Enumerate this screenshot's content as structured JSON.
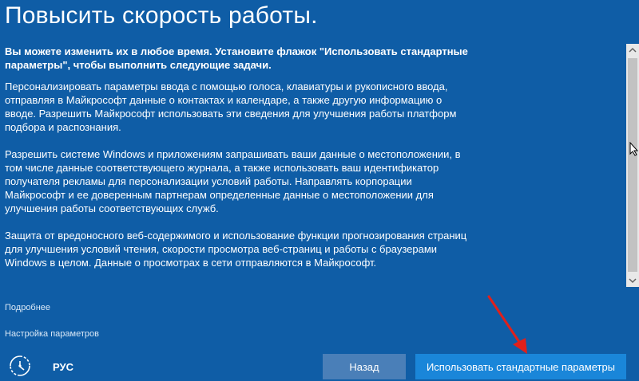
{
  "header": {
    "title": "Повысить скорость работы."
  },
  "intro": {
    "text": "Вы можете изменить их в любое время. Установите флажок \"Использовать стандартные параметры\", чтобы выполнить следующие задачи."
  },
  "paragraphs": [
    "Персонализировать параметры ввода с помощью голоса, клавиатуры и рукописного ввода, отправляя в Майкрософт данные о контактах и календаре, а также другую информацию о вводе. Разрешить Майкрософт использовать эти сведения для улучшения работы платформ подбора и распознания.",
    "Разрешить системе Windows и приложениям запрашивать ваши данные о местоположении, в том числе данные соответствующего журнала, а также использовать ваш идентификатор получателя рекламы для персонализации условий работы. Направлять корпорации Майкрософт и ее доверенным партнерам определенные данные о местоположении для улучшения работы соответствующих служб.",
    "Защита от вредоносного веб-содержимого и использование функции прогнозирования страниц для улучшения условий чтения, скорости просмотра веб-страниц и работы с браузерами Windows в целом. Данные о просмотрах в сети отправляются в Майкрософт."
  ],
  "links": {
    "more": "Подробнее",
    "settings": "Настройка параметров"
  },
  "footer": {
    "language": "РУС",
    "back_label": "Назад",
    "default_label": "Использовать стандартные параметры"
  },
  "icons": {
    "accessibility": "ease-of-access-icon",
    "scroll_up": "chevron-up-icon",
    "scroll_down": "chevron-down-icon",
    "annotation": "red-arrow-icon"
  },
  "colors": {
    "background": "#0f5da6",
    "primary_button": "#1a86d9",
    "secondary_button": "#4a7fb8",
    "annotation_arrow": "#e0201b"
  }
}
